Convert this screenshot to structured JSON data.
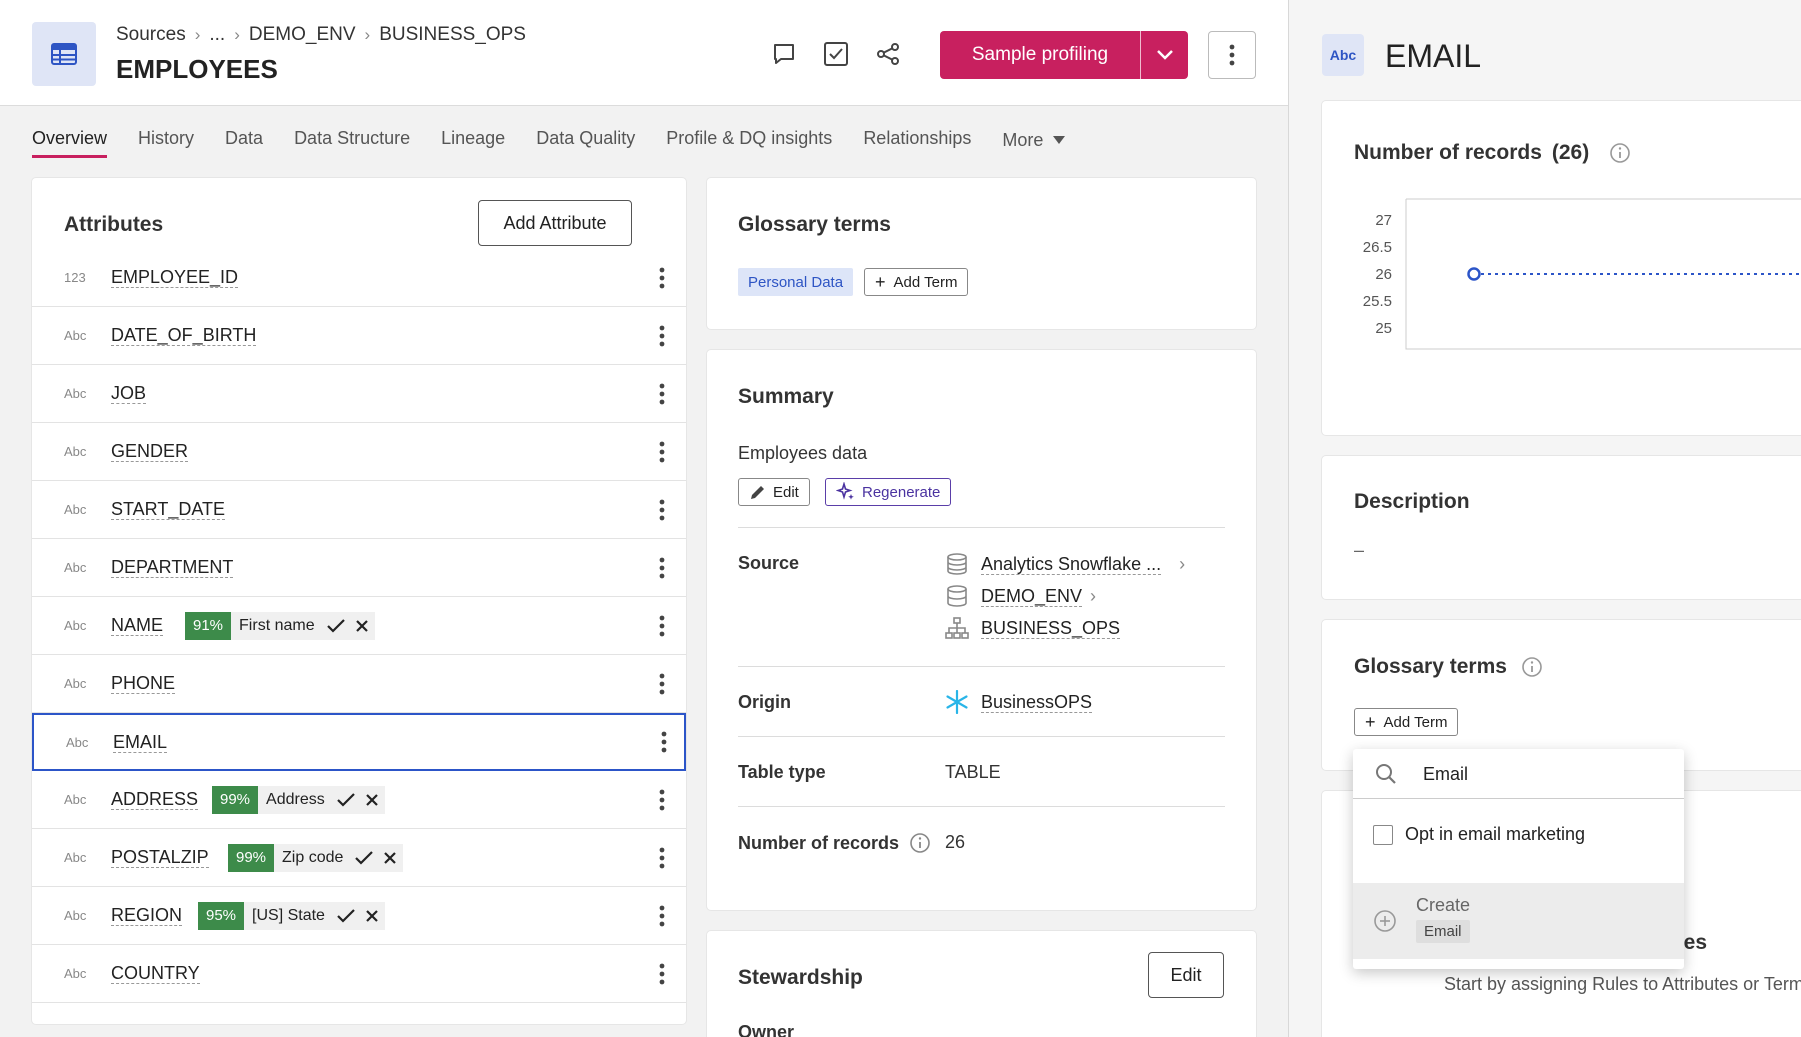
{
  "header": {
    "breadcrumb": [
      "Sources",
      "...",
      "DEMO_ENV",
      "BUSINESS_OPS"
    ],
    "title": "EMPLOYEES",
    "primary_action": "Sample profiling"
  },
  "tabs": [
    "Overview",
    "History",
    "Data",
    "Data Structure",
    "Lineage",
    "Data Quality",
    "Profile & DQ insights",
    "Relationships"
  ],
  "tabs_more": "More",
  "attributes": {
    "title": "Attributes",
    "add_button": "Add Attribute",
    "rows": [
      {
        "type": "123",
        "name": "EMPLOYEE_ID"
      },
      {
        "type": "Abc",
        "name": "DATE_OF_BIRTH"
      },
      {
        "type": "Abc",
        "name": "JOB"
      },
      {
        "type": "Abc",
        "name": "GENDER"
      },
      {
        "type": "Abc",
        "name": "START_DATE"
      },
      {
        "type": "Abc",
        "name": "DEPARTMENT"
      },
      {
        "type": "Abc",
        "name": "NAME",
        "suggestion": {
          "pct": "91%",
          "term": "First name"
        }
      },
      {
        "type": "Abc",
        "name": "PHONE"
      },
      {
        "type": "Abc",
        "name": "EMAIL",
        "selected": true
      },
      {
        "type": "Abc",
        "name": "ADDRESS",
        "suggestion": {
          "pct": "99%",
          "term": "Address"
        }
      },
      {
        "type": "Abc",
        "name": "POSTALZIP",
        "suggestion": {
          "pct": "99%",
          "term": "Zip code"
        }
      },
      {
        "type": "Abc",
        "name": "REGION",
        "suggestion": {
          "pct": "95%",
          "term": "[US] State"
        }
      },
      {
        "type": "Abc",
        "name": "COUNTRY"
      }
    ]
  },
  "glossary": {
    "title": "Glossary terms",
    "terms": [
      "Personal Data"
    ],
    "add_term": "Add Term"
  },
  "summary": {
    "title": "Summary",
    "description": "Employees data",
    "edit_label": "Edit",
    "regenerate_label": "Regenerate",
    "source_label": "Source",
    "source_items": [
      "Analytics Snowflake ...",
      "DEMO_ENV",
      "BUSINESS_OPS"
    ],
    "origin_label": "Origin",
    "origin_value": "BusinessOPS",
    "table_type_label": "Table type",
    "table_type_value": "TABLE",
    "records_label": "Number of records",
    "records_value": "26"
  },
  "stewardship": {
    "title": "Stewardship",
    "edit_label": "Edit",
    "owner_label": "Owner"
  },
  "panel": {
    "type_badge": "Abc",
    "title": "EMAIL",
    "records_title": "Number of records",
    "records_count": "(26)",
    "description_title": "Description",
    "description_value": "–",
    "glossary_title": "Glossary terms",
    "add_term": "Add Term",
    "rules_title_partial": "ules",
    "rules_hint": "Start by assigning Rules to Attributes or Terms"
  },
  "chart_data": {
    "type": "line",
    "yticks": [
      "27",
      "26.5",
      "26",
      "25.5",
      "25"
    ],
    "ylim": [
      24.8,
      27.2
    ],
    "values": [
      26
    ]
  },
  "dropdown": {
    "search_value": "Email",
    "options": [
      "Opt in email marketing"
    ],
    "create_label": "Create",
    "create_value": "Email"
  },
  "colors": {
    "primary": "#c8205f",
    "selected_border": "#2c55c8",
    "suggestion_green": "#3d8b4a",
    "chart_line": "#2c55c8"
  }
}
